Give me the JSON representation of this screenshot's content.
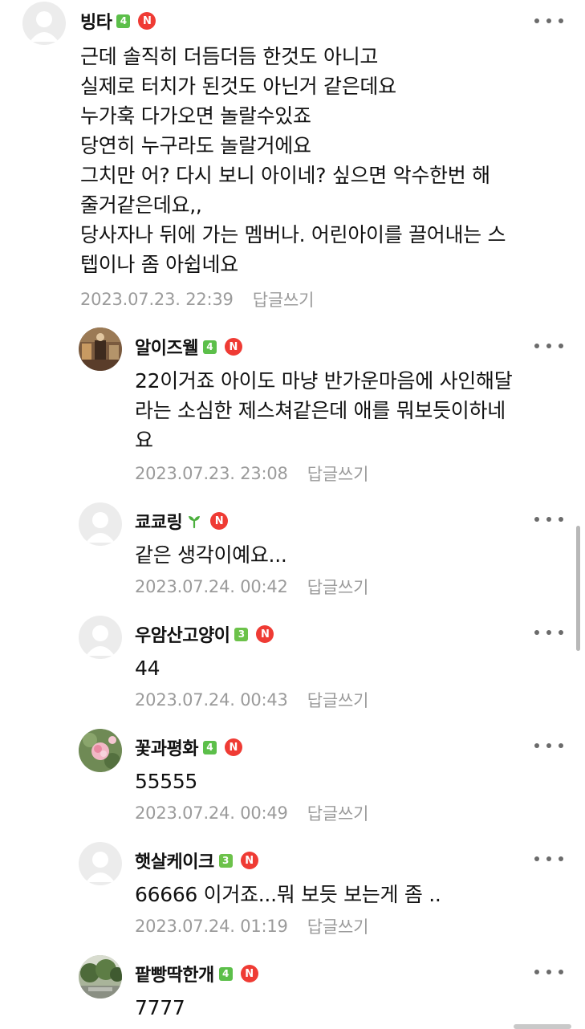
{
  "colors": {
    "level_badge": "#5cbf4a",
    "n_badge": "#ef3b34",
    "meta_text": "#9b9b9b"
  },
  "n_badge_label": "N",
  "comments": [
    {
      "nickname": "빙타",
      "level": "4",
      "avatar": "default",
      "body": "근데 솔직히 더듬더듬 한것도 아니고\n실제로 터치가 된것도 아닌거 같은데요\n누가훅 다가오면 놀랄수있죠\n당연히 누구라도 놀랄거에요\n그치만 어? 다시 보니 아이네? 싶으면 악수한번 해\n줄거같은데요,,\n당사자나 뒤에 가는 멤버나. 어린아이를 끌어내는 스\n텝이나 좀 아쉽네요",
      "timestamp": "2023.07.23. 22:39",
      "reply_label": "답글쓰기"
    },
    {
      "nickname": "알이즈웰",
      "level": "4",
      "avatar": "photo",
      "body": "22이거죠 아이도 마냥 반가운마음에 사인해달\n라는 소심한 제스쳐같은데 애를 뭐보듯이하네\n요",
      "timestamp": "2023.07.23. 23:08",
      "reply_label": "답글쓰기"
    },
    {
      "nickname": "쿄쿄링",
      "level": "sprout",
      "avatar": "default",
      "body": "같은 생각이예요...",
      "timestamp": "2023.07.24. 00:42",
      "reply_label": "답글쓰기"
    },
    {
      "nickname": "우암산고양이",
      "level": "3",
      "avatar": "default",
      "body": "44",
      "timestamp": "2023.07.24. 00:43",
      "reply_label": "답글쓰기"
    },
    {
      "nickname": "꽃과평화",
      "level": "4",
      "avatar": "flower",
      "body": "55555",
      "timestamp": "2023.07.24. 00:49",
      "reply_label": "답글쓰기"
    },
    {
      "nickname": "햇살케이크",
      "level": "3",
      "avatar": "default",
      "body": "66666 이거죠...뭐 보듯 보는게 좀 ..",
      "timestamp": "2023.07.24. 01:19",
      "reply_label": "답글쓰기"
    },
    {
      "nickname": "팥빵딱한개",
      "level": "4",
      "avatar": "landscape",
      "body": "7777",
      "timestamp": "",
      "reply_label": ""
    }
  ]
}
